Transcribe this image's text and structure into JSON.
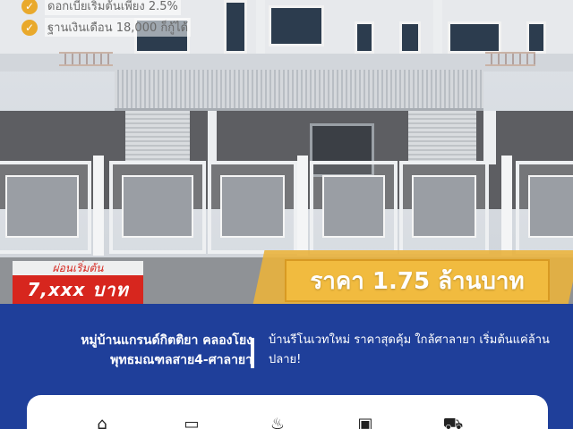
{
  "promo": {
    "bullets": [
      "ดอกเบี้ยเริ่มต้นเพียง 2.5%",
      "ฐานเงินเดือน 18,000 ก็กู้ได้"
    ],
    "check_icon": "check-circle-icon"
  },
  "installment": {
    "label": "ผ่อนเริ่มต้น",
    "value": "7,xxx บาท"
  },
  "price": {
    "text": "ราคา 1.75 ล้านบาท"
  },
  "project": {
    "title_line1": "หมู่บ้านแกรนด์กิตติยา คลองโยง",
    "title_line2": "พุทธมณฑลสาย4-ศาลายา",
    "description": "บ้านรีโนเวทใหม่ ราคาสุดคุ้ม ใกล้ศาลายา เริ่มต้นแค่ล้านปลาย!"
  },
  "features": {
    "icons": [
      "house-icon",
      "bed-icon",
      "shower-icon",
      "appliances-icon",
      "car-icon"
    ]
  },
  "colors": {
    "accent_gold": "#f1bb3f",
    "installment_red": "#d7261e",
    "band_blue": "#1f3f9a"
  }
}
